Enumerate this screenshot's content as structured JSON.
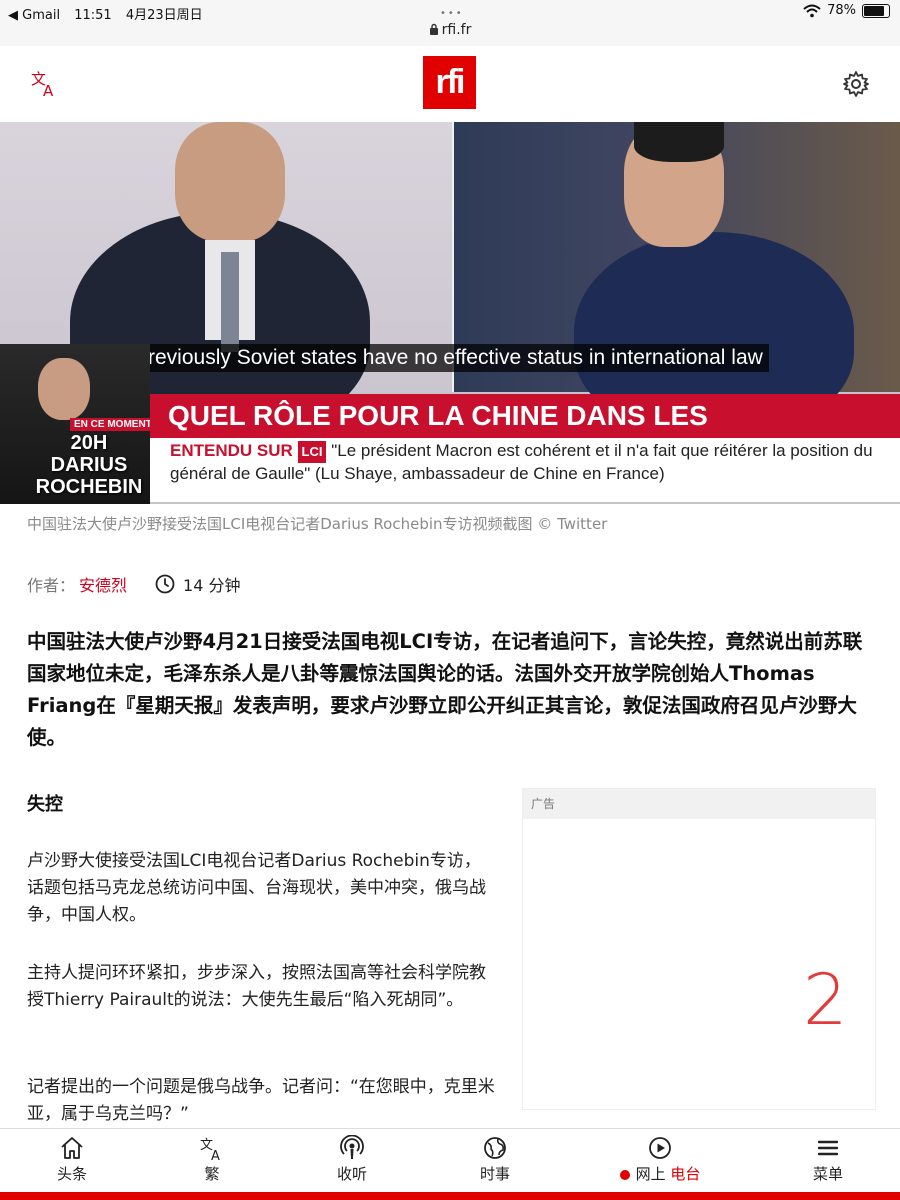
{
  "status_bar": {
    "back_app": "◀ Gmail",
    "time": "11:51",
    "date": "4月23日周日",
    "url": "rfi.fr",
    "battery": "78%",
    "battery_level": 0.78
  },
  "header": {
    "logo_text": "rfi",
    "brand_color": "#e00000"
  },
  "hero": {
    "subtitle": "Previously Soviet states have no effective status in international law",
    "headline": "QUEL RÔLE POUR LA CHINE DANS LES NÉGOCIATIONS ?",
    "heard_on": "ENTENDU SUR",
    "channel": "LCI",
    "quote": "\"Le président Macron est cohérent et il n'a fait que réitérer la position du général de Gaulle\" (Lu Shaye, ambassadeur de Chine en France)",
    "anchor_tag": "EN CE MOMENT",
    "anchor_name": "20H DARIUS ROCHEBIN"
  },
  "caption": "中国驻法大使卢沙野接受法国LCI电视台记者Darius Rochebin专访视频截图 © Twitter",
  "meta": {
    "author_label": "作者：",
    "author": "安德烈",
    "duration": "14 分钟"
  },
  "article": {
    "lead": "中国驻法大使卢沙野4月21日接受法国电视LCI专访，在记者追问下，言论失控，竟然说出前苏联国家地位未定，毛泽东杀人是八卦等震惊法国舆论的话。法国外交开放学院创始人Thomas Friang在『星期天报』发表声明，要求卢沙野立即公开纠正其言论，敦促法国政府召见卢沙野大使。",
    "section_title": "失控",
    "paragraphs": [
      "卢沙野大使接受法国LCI电视台记者Darius Rochebin专访，话题包括马克龙总统访问中国、台海现状，美中冲突，俄乌战争，中国人权。",
      "主持人提问环环紧扣，步步深入，按照法国高等社会科学院教授Thierry Pairault的说法：大使先生最后“陷入死胡同”。",
      "记者提出的一个问题是俄乌战争。记者问：“在您眼中，克里米亚，属于乌克兰吗？”"
    ]
  },
  "ad": {
    "label": "广告",
    "handwritten_mark": "2"
  },
  "tabbar": {
    "tabs": [
      {
        "label": "头条",
        "icon": "home-icon"
      },
      {
        "label": "繁",
        "icon": "translate-icon"
      },
      {
        "label": "收听",
        "icon": "podcast-icon"
      },
      {
        "label": "时事",
        "icon": "globe-icon"
      },
      {
        "label_a": "网上",
        "label_b": "电台",
        "icon": "play-circle-icon"
      },
      {
        "label": "菜单",
        "icon": "menu-icon"
      }
    ]
  }
}
